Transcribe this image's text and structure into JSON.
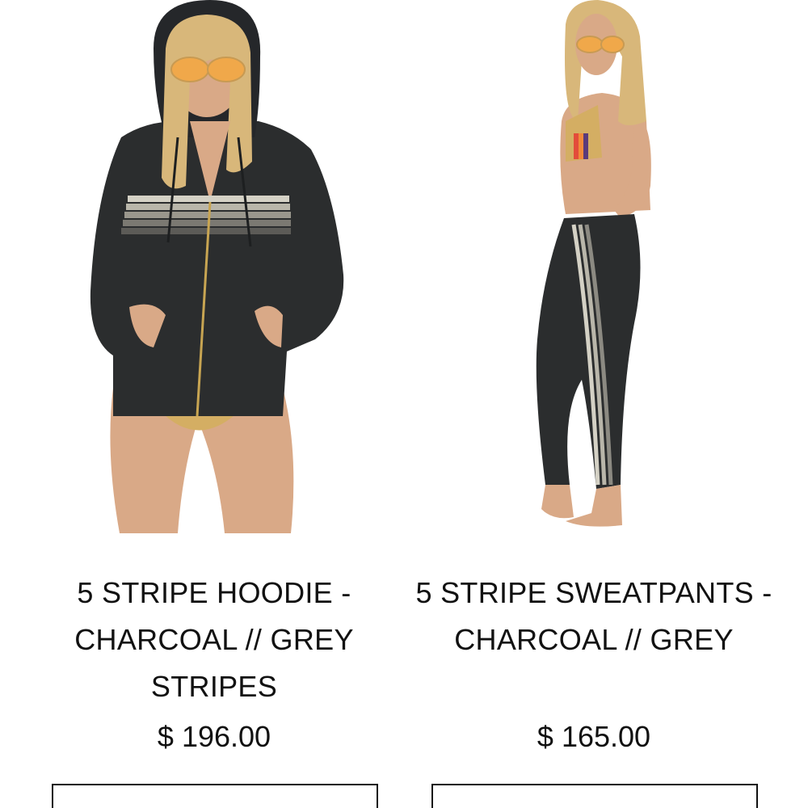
{
  "products": [
    {
      "image_alt": "5 STRIPE HOODIE - CHARCOAL // GREY STRIPES",
      "title": "5 STRIPE HOODIE - CHARCOAL // GREY STRIPES",
      "price": "$ 196.00",
      "button_label": ""
    },
    {
      "image_alt": "5 STRIPE SWEATPANTS - CHARCOAL // GREY",
      "title": "5 STRIPE SWEATPANTS - CHARCOAL // GREY",
      "price": "$ 165.00",
      "button_label": ""
    }
  ],
  "colors": {
    "charcoal": "#2b2d2e",
    "grey_stripe": "#b9b6aa",
    "skin": "#d9a987",
    "hair": "#d8b77a"
  }
}
